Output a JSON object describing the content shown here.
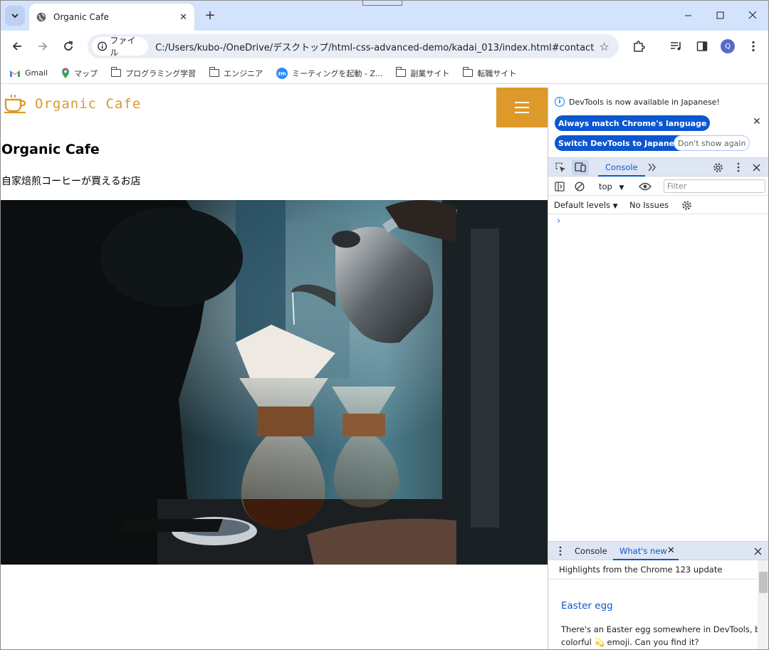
{
  "browser": {
    "tab_title": "Organic Cafe",
    "chip_label": "ファイル",
    "url": "C:/Users/kubo-/OneDrive/デスクトップ/html-css-advanced-demo/kadai_013/index.html#contact",
    "avatar_letter": "Q",
    "bookmarks": [
      {
        "label": "Gmail",
        "icon": "gmail-icon"
      },
      {
        "label": "マップ",
        "icon": "maps-icon"
      },
      {
        "label": "プログラミング学習",
        "icon": "folder-icon"
      },
      {
        "label": "エンジニア",
        "icon": "folder-icon"
      },
      {
        "label": "ミーティングを起動 - Z...",
        "icon": "zoom-icon"
      },
      {
        "label": "副業サイト",
        "icon": "folder-icon"
      },
      {
        "label": "転職サイト",
        "icon": "folder-icon"
      }
    ]
  },
  "site": {
    "logo_text": "Organic Cafe",
    "title": "Organic Cafe",
    "subtitle": "自家焙煎コーヒーが買えるお店",
    "accent_color": "#dd9a2a",
    "hero_alt": "Pour-over coffee being brewed"
  },
  "devtools": {
    "notice_text": "DevTools is now available in Japanese!",
    "btn_match": "Always match Chrome's language",
    "btn_switch": "Switch DevTools to Japanese",
    "btn_dont_show": "Don't show again",
    "tab_console": "Console",
    "context": "top",
    "filter_placeholder": "Filter",
    "default_levels": "Default levels",
    "no_issues": "No Issues",
    "drawer_tab_console": "Console",
    "drawer_tab_whats_new": "What's new",
    "whats_new_header": "Highlights from the Chrome 123 update",
    "whats_new_title": "Easter egg",
    "whats_new_line1": "There's an Easter egg somewhere in DevTools, behind a",
    "whats_new_line2_a": "colorful",
    "whats_new_line2_b": "emoji. Can you find it?"
  }
}
